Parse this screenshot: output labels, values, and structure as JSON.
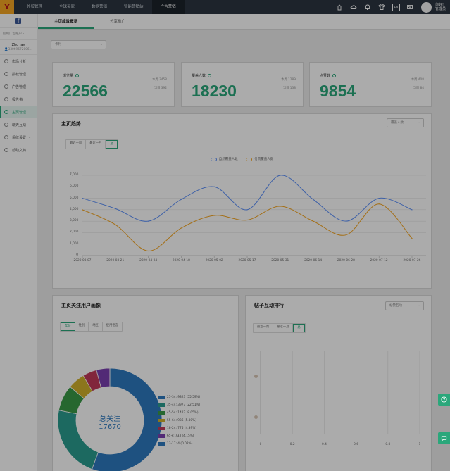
{
  "topbar": {
    "logo_text": "Y",
    "nav": [
      "外贸管理",
      "全球买家",
      "数据营销",
      "智能营销站",
      "广告营销"
    ],
    "active_nav": 4,
    "icons": [
      "bell-hand-icon",
      "cloud-icon",
      "bell-icon",
      "shirt-icon",
      "translate-icon",
      "mail-icon"
    ],
    "translate_label": "EN",
    "user": {
      "greeting": "你好!",
      "role": "管理员"
    }
  },
  "sidebar": {
    "control_label": "控制广告账户",
    "profile": {
      "name": "Zhu Jay",
      "id": "33069672006..."
    },
    "items": [
      {
        "label": "市场分析",
        "icon": "chart-icon"
      },
      {
        "label": "授权管理",
        "icon": "user-icon"
      },
      {
        "label": "广告管理",
        "icon": "ad-icon"
      },
      {
        "label": "报告书",
        "icon": "report-icon"
      },
      {
        "label": "主页管理",
        "icon": "share-icon"
      },
      {
        "label": "聊天互动",
        "icon": "chat-icon"
      },
      {
        "label": "系统设置",
        "icon": "settings-icon"
      },
      {
        "label": "帮助文档",
        "icon": "help-icon"
      }
    ],
    "active_item": 4
  },
  "tabs": [
    "主页成效概览",
    "分享推广"
  ],
  "active_tab": 0,
  "page_select": {
    "value": "卡利"
  },
  "stats": [
    {
      "label": "浏览量",
      "value": "22566",
      "meta1": "本周 3458",
      "meta2": "当日 392"
    },
    {
      "label": "覆盖人数",
      "value": "18230",
      "meta1": "本周 1289",
      "meta2": "当日 138"
    },
    {
      "label": "点赞数",
      "value": "9854",
      "meta1": "本周 408",
      "meta2": "当日 84"
    }
  ],
  "trend": {
    "title": "主页趋势",
    "select_value": "覆盖人数",
    "periods": [
      "最近一周",
      "最近一月",
      "总"
    ],
    "active_period": 2
  },
  "chart_data": {
    "type": "line",
    "x": [
      "2020-03-07",
      "2020-03-21",
      "2020-04-04",
      "2020-04-18",
      "2020-05-02",
      "2020-05-17",
      "2020-05-31",
      "2020-06-14",
      "2020-06-28",
      "2020-07-12",
      "2020-07-26"
    ],
    "ylim": [
      0,
      7000
    ],
    "yticks": [
      0,
      1000,
      2000,
      3000,
      4000,
      5000,
      6000,
      7000
    ],
    "grid": true,
    "legend_position": "top",
    "series": [
      {
        "name": "自然覆盖人数",
        "color": "#5b8ff9",
        "values": [
          5000,
          4100,
          3000,
          4900,
          6000,
          4000,
          7000,
          4900,
          3000,
          5000,
          4000
        ]
      },
      {
        "name": "付费覆盖人数",
        "color": "#f5a623",
        "values": [
          4000,
          2700,
          400,
          2400,
          3500,
          3100,
          4300,
          3000,
          1800,
          4500,
          1500
        ]
      }
    ]
  },
  "audience": {
    "title": "主页关注用户画像",
    "tabs": [
      "年龄",
      "性别",
      "地区",
      "使用语言"
    ],
    "active_tab": 0,
    "center_label": "总关注",
    "center_value": "17670",
    "slices": [
      {
        "label": "25-34: 9823 (55.59%)",
        "value": 9823,
        "color": "#2e7abf"
      },
      {
        "label": "35-44: 3977 (22.51%)",
        "value": 3977,
        "color": "#2a9d8f"
      },
      {
        "label": "45-54: 1422 (8.05%)",
        "value": 1422,
        "color": "#3a9a46"
      },
      {
        "label": "55-64: 936 (5.30%)",
        "value": 936,
        "color": "#d1b02a"
      },
      {
        "label": "18-24: 775 (4.39%)",
        "value": 775,
        "color": "#c0395a"
      },
      {
        "label": "65+: 733 (4.15%)",
        "value": 733,
        "color": "#7b3fb0"
      },
      {
        "label": "13-17: 4 (0.02%)",
        "value": 4,
        "color": "#2e7abf"
      }
    ]
  },
  "ranking": {
    "title": "帖子互动排行",
    "select_value": "帖赞互动",
    "periods": [
      "最近一周",
      "最近一月",
      "总"
    ],
    "active_period": 2,
    "x_ticks": [
      "0",
      "0.2",
      "0.4",
      "0.6",
      "0.8",
      "1"
    ]
  }
}
